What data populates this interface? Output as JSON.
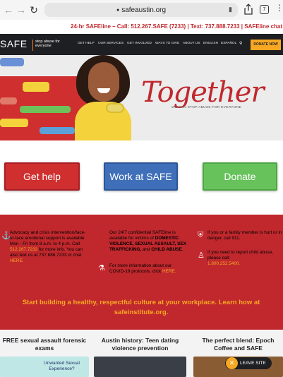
{
  "browser": {
    "url": "safeaustin.org",
    "tab_count": "7"
  },
  "hotline": "24-hr SAFEline – Call: 512.267.SAFE (7233)  |  Text: 737.888.7233  |  SAFEline chat",
  "nav": {
    "logo": "SAFE",
    "tagline": "stop abuse for everyone",
    "items": [
      "GET HELP",
      "OUR SERVICES",
      "GET INVOLVED",
      "WAYS TO GIVE",
      "ABOUT US",
      "ENGLISH",
      "ESPAÑOL"
    ],
    "donate_label": "DONATE NOW"
  },
  "hero": {
    "headline": "Together",
    "subline": "WE CAN STOP ABUSE FOR EVERYONE"
  },
  "cta": {
    "get_help": "Get help",
    "work": "Work at SAFE",
    "donate": "Donate"
  },
  "info": {
    "col1": {
      "text1": "Advocacy and crisis intervention/face-to-face emotional support is available Mon - Fri from 8 a.m. to 4 p.m. Call ",
      "phone": "512.267.7233",
      "text2": " for more info. You can also text us at 737.888.7233 or chat ",
      "here": "HERE."
    },
    "col2": {
      "text1": "Our 24/7 confidential SAFEline is available for victims of ",
      "bold1": "DOMESTIC VIOLENCE, SEXUAL ASSAULT, SEX TRAFFICKING,",
      "text2": " and ",
      "bold2": "CHILD ABUSE",
      "text3": ".",
      "text4": "For more information about our COVID-19 protocols, click ",
      "here": "HERE."
    },
    "col3": {
      "text1": "If you or a family member is hurt or in danger, call 911.",
      "text2": "If you need to report child abuse, please call:",
      "phone": "1.800.252.5400."
    },
    "slogan": "Start building a healthy, respectful culture at your workplace. Learn how at safeinstitute.org."
  },
  "cards": [
    {
      "title": "FREE sexual assault forensic exams",
      "image_text": "Unwanted Sexual Experience?"
    },
    {
      "title": "Austin history: Teen dating violence prevention"
    },
    {
      "title": "The perfect blend: Epoch Coffee and SAFE"
    }
  ],
  "leave_site": "LEAVE SITE",
  "colors": {
    "brand_red": "#c0282d",
    "accent_orange": "#f7a823",
    "work_blue": "#3f6fb8",
    "donate_green": "#67c25c",
    "nav_dark": "#1e1f22"
  }
}
